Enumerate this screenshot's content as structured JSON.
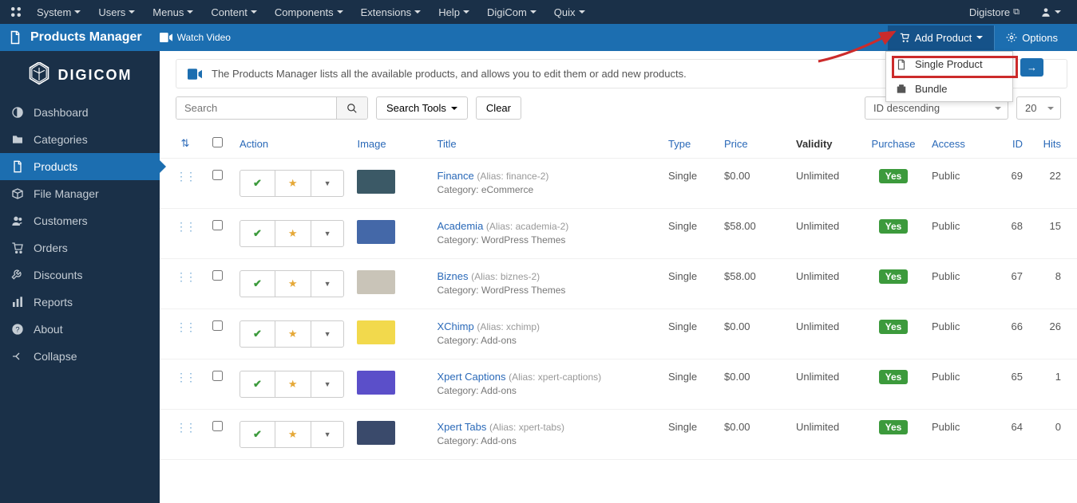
{
  "topmenu": [
    "System",
    "Users",
    "Menus",
    "Content",
    "Components",
    "Extensions",
    "Help",
    "DigiCom",
    "Quix"
  ],
  "siteName": "Digistore",
  "header": {
    "title": "Products Manager",
    "watchVideo": "Watch Video",
    "addProduct": "Add Product",
    "options": "Options"
  },
  "dropdown": {
    "singleProduct": "Single Product",
    "bundle": "Bundle"
  },
  "logo": "DIGICOM",
  "sidebar": [
    {
      "icon": "◐",
      "label": "Dashboard"
    },
    {
      "icon": "📁",
      "label": "Categories"
    },
    {
      "icon": "🗎",
      "label": "Products",
      "active": true
    },
    {
      "icon": "📦",
      "label": "File Manager"
    },
    {
      "icon": "👥",
      "label": "Customers"
    },
    {
      "icon": "🛒",
      "label": "Orders"
    },
    {
      "icon": "🔧",
      "label": "Discounts"
    },
    {
      "icon": "📊",
      "label": "Reports"
    },
    {
      "icon": "❓",
      "label": "About"
    },
    {
      "icon": "←",
      "label": "Collapse"
    }
  ],
  "banner": "The Products Manager lists all the available products, and allows you to edit them or add new products.",
  "search": {
    "placeholder": "Search",
    "tools": "Search Tools",
    "clear": "Clear"
  },
  "sort": {
    "order": "ID descending",
    "limit": "20"
  },
  "columns": {
    "action": "Action",
    "image": "Image",
    "title": "Title",
    "type": "Type",
    "price": "Price",
    "validity": "Validity",
    "purchase": "Purchase",
    "access": "Access",
    "id": "ID",
    "hits": "Hits"
  },
  "catLabel": "Category:",
  "aliasLabel": "Alias:",
  "yesBadge": "Yes",
  "rows": [
    {
      "title": "Finance",
      "alias": "finance-2",
      "category": "eCommerce",
      "type": "Single",
      "price": "$0.00",
      "validity": "Unlimited",
      "access": "Public",
      "id": "69",
      "hits": "22",
      "thumb": "#3b5966"
    },
    {
      "title": "Academia",
      "alias": "academia-2",
      "category": "WordPress Themes",
      "type": "Single",
      "price": "$58.00",
      "validity": "Unlimited",
      "access": "Public",
      "id": "68",
      "hits": "15",
      "thumb": "#4468a8"
    },
    {
      "title": "Biznes",
      "alias": "biznes-2",
      "category": "WordPress Themes",
      "type": "Single",
      "price": "$58.00",
      "validity": "Unlimited",
      "access": "Public",
      "id": "67",
      "hits": "8",
      "thumb": "#c9c4b8"
    },
    {
      "title": "XChimp",
      "alias": "xchimp",
      "category": "Add-ons",
      "type": "Single",
      "price": "$0.00",
      "validity": "Unlimited",
      "access": "Public",
      "id": "66",
      "hits": "26",
      "thumb": "#f2d94c"
    },
    {
      "title": "Xpert Captions",
      "alias": "xpert-captions",
      "category": "Add-ons",
      "type": "Single",
      "price": "$0.00",
      "validity": "Unlimited",
      "access": "Public",
      "id": "65",
      "hits": "1",
      "thumb": "#5b4fc9"
    },
    {
      "title": "Xpert Tabs",
      "alias": "xpert-tabs",
      "category": "Add-ons",
      "type": "Single",
      "price": "$0.00",
      "validity": "Unlimited",
      "access": "Public",
      "id": "64",
      "hits": "0",
      "thumb": "#3a4a6b"
    }
  ]
}
